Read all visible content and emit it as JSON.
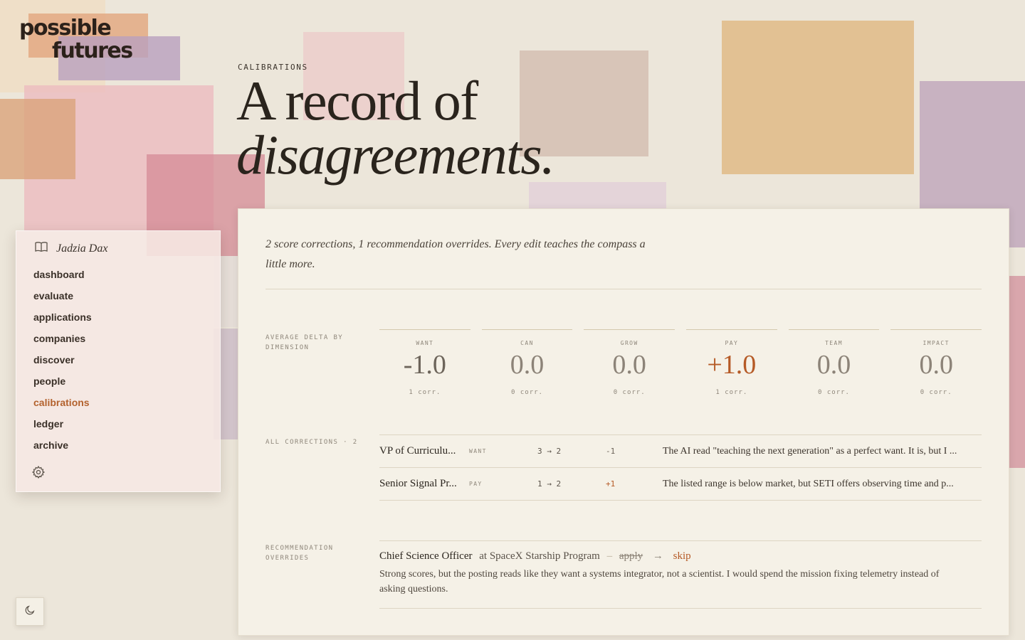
{
  "brand": {
    "line1": "possible",
    "line2": "futures"
  },
  "page": {
    "eyebrow": "CALIBRATIONS",
    "headline_line1": "A record of",
    "headline_line2": "disagreements."
  },
  "sidebar": {
    "user_name": "Jadzia Dax",
    "items": [
      {
        "label": "dashboard"
      },
      {
        "label": "evaluate"
      },
      {
        "label": "applications"
      },
      {
        "label": "companies"
      },
      {
        "label": "discover"
      },
      {
        "label": "people"
      },
      {
        "label": "calibrations",
        "active": true
      },
      {
        "label": "ledger"
      },
      {
        "label": "archive"
      }
    ]
  },
  "summary": "2 score corrections, 1 recommendation overrides. Every edit teaches the compass a little more.",
  "average_delta": {
    "label": "AVERAGE DELTA BY DIMENSION",
    "dimensions": [
      {
        "name": "WANT",
        "value": "-1.0",
        "count": "1 corr."
      },
      {
        "name": "CAN",
        "value": "0.0",
        "count": "0 corr."
      },
      {
        "name": "GROW",
        "value": "0.0",
        "count": "0 corr."
      },
      {
        "name": "PAY",
        "value": "+1.0",
        "count": "1 corr."
      },
      {
        "name": "TEAM",
        "value": "0.0",
        "count": "0 corr."
      },
      {
        "name": "IMPACT",
        "value": "0.0",
        "count": "0 corr."
      }
    ]
  },
  "corrections": {
    "label": "ALL CORRECTIONS · 2",
    "rows": [
      {
        "title": "VP of Curriculu...",
        "dimension": "WANT",
        "change": "3 → 2",
        "delta": "-1",
        "note": "The AI read \"teaching the next generation\" as a perfect want. It is, but I ..."
      },
      {
        "title": "Senior Signal Pr...",
        "dimension": "PAY",
        "change": "1 → 2",
        "delta": "+1",
        "note": "The listed range is below market, but SETI offers observing time and p..."
      }
    ]
  },
  "overrides": {
    "label": "RECOMMENDATION OVERRIDES",
    "items": [
      {
        "role": "Chief Science Officer",
        "company": "at SpaceX Starship Program",
        "separator": "–",
        "from": "apply",
        "arrow": "→",
        "to": "skip",
        "note": "Strong scores, but the posting reads like they want a systems integrator, not a scientist. I would spend the mission fixing telemetry instead of asking questions."
      }
    ]
  },
  "colors": {
    "accent": "#b55a26",
    "background": "#ece6da",
    "panel": "#f5f1e7"
  },
  "icons": [
    "book-icon",
    "gear-icon",
    "moon-icon"
  ]
}
